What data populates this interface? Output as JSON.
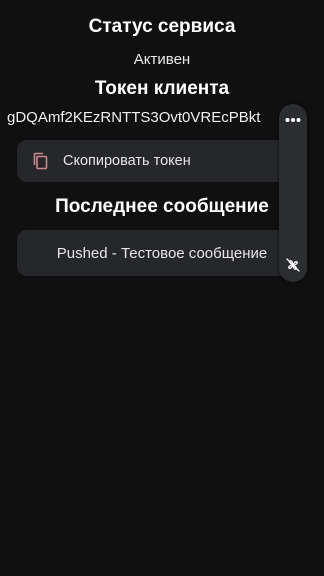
{
  "service_status": {
    "title": "Статус сервиса",
    "value": "Активен"
  },
  "client_token": {
    "title": "Токен клиента",
    "value": "gDQAmf2KEzRNTTS3Ovt0VREcPBkt"
  },
  "copy_button": {
    "label": "Скопировать токен",
    "icon": "copy-icon",
    "icon_color": "#c98a8f"
  },
  "last_message": {
    "title": "Последнее сообщение",
    "text": "Pushed - Тестовое сообщение"
  },
  "floating_toolbar": {
    "menu_icon": "more-horizontal-icon",
    "action_icon": "fan-off-icon"
  },
  "colors": {
    "background": "#101010",
    "card": "#26272b",
    "text": "#ffffff"
  }
}
